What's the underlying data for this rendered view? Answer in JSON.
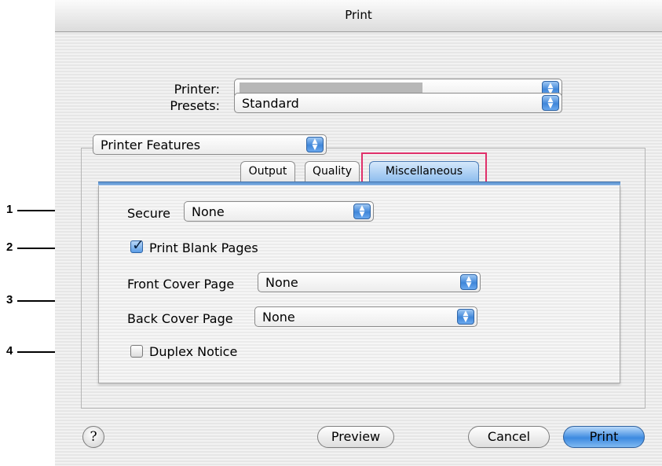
{
  "window": {
    "title": "Print"
  },
  "printer": {
    "label": "Printer:",
    "value": ""
  },
  "presets": {
    "label": "Presets:",
    "value": "Standard"
  },
  "panel_select": {
    "value": "Printer Features"
  },
  "tabs": [
    {
      "label": "Output",
      "selected": false
    },
    {
      "label": "Quality",
      "selected": false
    },
    {
      "label": "Miscellaneous",
      "selected": true
    }
  ],
  "secure": {
    "label": "Secure",
    "value": "None"
  },
  "print_blank_pages": {
    "label": "Print Blank Pages",
    "checked": true
  },
  "front_cover": {
    "label": "Front Cover Page",
    "value": "None"
  },
  "back_cover": {
    "label": "Back Cover Page",
    "value": "None"
  },
  "duplex_notice": {
    "label": "Duplex Notice",
    "checked": false
  },
  "buttons": {
    "help": "?",
    "preview": "Preview",
    "cancel": "Cancel",
    "print": "Print"
  },
  "callouts": [
    "1",
    "2",
    "3",
    "4"
  ],
  "colors": {
    "accent": "#3f86d9",
    "highlight": "#e0306a"
  }
}
